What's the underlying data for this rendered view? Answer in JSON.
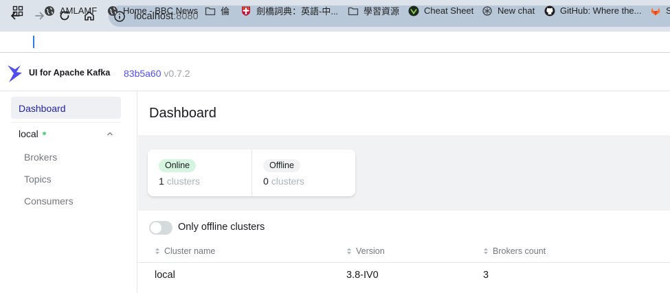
{
  "browser": {
    "url_host": "localhost",
    "url_port": ":8080",
    "bookmarks": [
      {
        "label": "AMLAMF",
        "icon": "globe-icon"
      },
      {
        "label": "Home - BBC News",
        "icon": "globe-icon"
      },
      {
        "label": "倫",
        "icon": "folder-icon"
      },
      {
        "label": "劍橋詞典：英語-中...",
        "icon": "cambridge-crest-icon"
      },
      {
        "label": "學習資源",
        "icon": "folder-icon"
      },
      {
        "label": "Cheat Sheet",
        "icon": "cheat-sheet-icon"
      },
      {
        "label": "New chat",
        "icon": "openai-icon"
      },
      {
        "label": "GitHub: Where the...",
        "icon": "github-icon"
      },
      {
        "label": "S",
        "icon": "gitlab-icon"
      }
    ]
  },
  "app": {
    "title": "UI for Apache Kafka",
    "version_hash": "83b5a60",
    "version_tag": " v0.7.2",
    "brand_color": "#4f4ff0"
  },
  "sidebar": {
    "dashboard": "Dashboard",
    "cluster": {
      "name": "local",
      "status_color": "#5cd685"
    },
    "sub_items": [
      "Brokers",
      "Topics",
      "Consumers"
    ]
  },
  "main": {
    "title": "Dashboard",
    "metrics": {
      "online": {
        "label": "Online",
        "count": "1",
        "unit": "clusters"
      },
      "offline": {
        "label": "Offline",
        "count": "0",
        "unit": "clusters"
      }
    },
    "toggle": {
      "label": "Only offline clusters",
      "on": false
    },
    "table": {
      "columns": [
        "Cluster name",
        "Version",
        "Brokers count"
      ],
      "rows": [
        [
          "local",
          "3.8-IV0",
          "3"
        ]
      ]
    }
  }
}
